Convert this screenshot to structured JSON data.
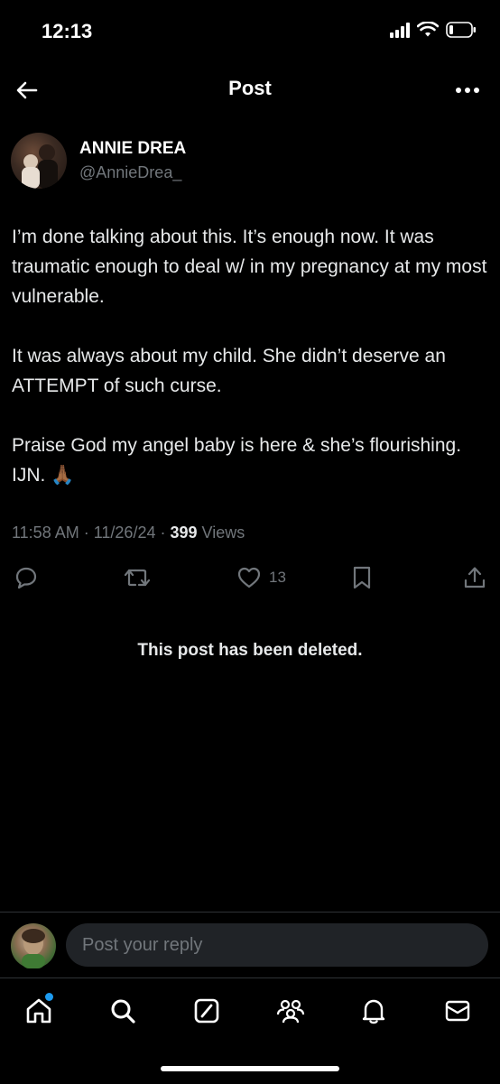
{
  "status_bar": {
    "time": "12:13"
  },
  "header": {
    "title": "Post"
  },
  "post": {
    "author_name": "ANNIE DREA",
    "author_handle": "@AnnieDrea_",
    "paragraphs": [
      "I’m done talking about this. It’s enough now. It was traumatic enough to deal w/ in my pregnancy at my most vulnerable.",
      "It was always about my child. She didn’t deserve an ATTEMPT of such curse.",
      "Praise God my angel baby is here & she’s flourishing. IJN. 🙏🏾"
    ],
    "time": "11:58 AM",
    "date": "11/26/24",
    "views_count": "399",
    "views_label": "Views",
    "like_count": "13"
  },
  "deleted_notice": "This post has been deleted.",
  "reply": {
    "placeholder": "Post your reply"
  },
  "icons": {
    "back": "arrow-left-icon",
    "more": "more-dots-icon",
    "reply": "reply-icon",
    "repost": "repost-icon",
    "like": "heart-icon",
    "bookmark": "bookmark-icon",
    "share": "share-icon",
    "home": "home-icon",
    "search": "search-icon",
    "grok": "grok-icon",
    "communities": "communities-icon",
    "notifications": "bell-icon",
    "messages": "mail-icon"
  },
  "colors": {
    "background": "#000000",
    "text": "#e7e9ea",
    "muted": "#71767b",
    "accent": "#1d9bf0"
  }
}
